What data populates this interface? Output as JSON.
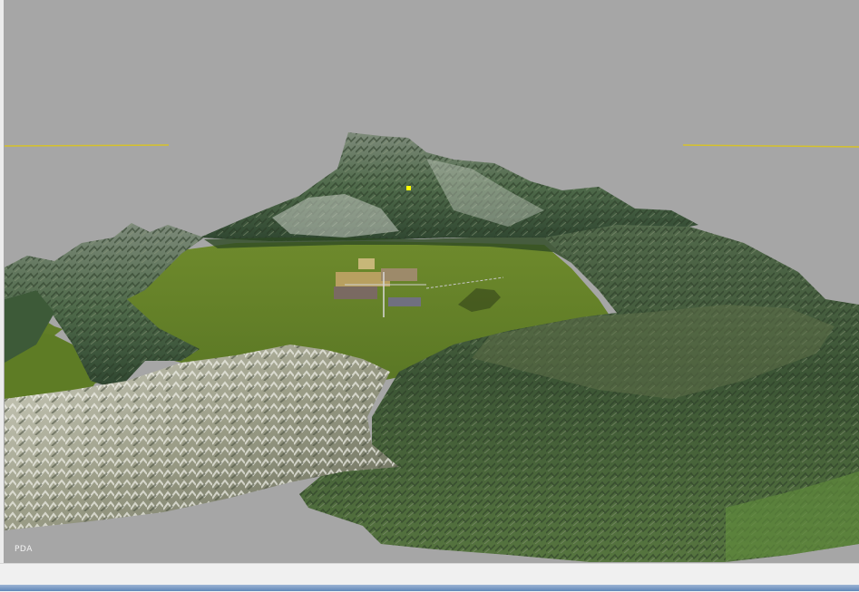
{
  "viewport": {
    "label": "PDA",
    "background_color": "#a6a6a6",
    "horizon_line_color": "#d6c22a",
    "marker_color": "#ffff00"
  },
  "scene": {
    "description_icons": [
      "mountain-terrain",
      "grass-plateau",
      "buildings",
      "aircraft-shadow"
    ]
  },
  "window": {
    "status_bar_color": "#f0f0f0",
    "taskbar_color": "#7a98c4"
  }
}
